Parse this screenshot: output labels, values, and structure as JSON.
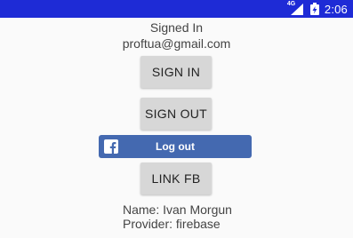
{
  "status_bar": {
    "network_label": "4G",
    "time": "2:06",
    "icons": [
      "signal-icon",
      "battery-icon"
    ],
    "background": "#1e2bd6"
  },
  "auth": {
    "status": "Signed In",
    "email": "proftua@gmail.com",
    "sign_in_label": "SIGN IN",
    "sign_out_label": "SIGN OUT",
    "fb_logout_label": "Log out",
    "link_fb_label": "LINK FB"
  },
  "profile": {
    "name": "Name: Ivan Morgun",
    "provider": "Provider: firebase"
  },
  "colors": {
    "background": "#fafafa",
    "button": "#d7d7d7",
    "facebook": "#4469b0",
    "text": "#444444"
  }
}
